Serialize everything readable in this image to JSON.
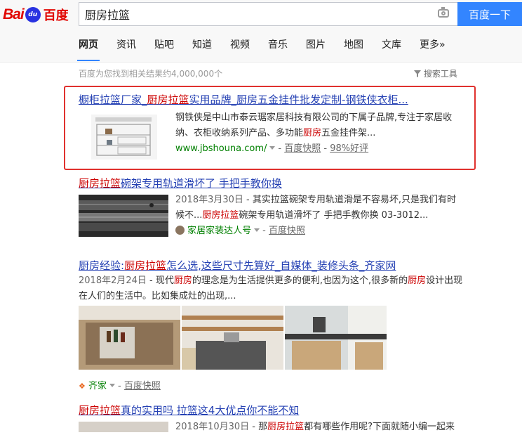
{
  "logo": {
    "latin": "Bai",
    "paw": "du",
    "cn": "百度"
  },
  "search": {
    "query": "厨房拉篮",
    "button": "百度一下"
  },
  "tabs": [
    "网页",
    "资讯",
    "贴吧",
    "知道",
    "视频",
    "音乐",
    "图片",
    "地图",
    "文库",
    "更多»"
  ],
  "count_text": "百度为您找到相关结果约4,000,000个",
  "tools_text": "搜索工具",
  "results": [
    {
      "title_pre": "橱柜拉篮厂家_",
      "title_em": "厨房拉篮",
      "title_post": "实用品牌_厨房五金挂件批发定制-钢铁侠衣柜...",
      "abstract_l1": "钢铁侠是中山市泰云琚家居科技有限公司的下属子品牌,专注于家居收",
      "abstract_l2_pre": "纳、衣柜收纳系列产品、多功能",
      "abstract_l2_em": "厨房",
      "abstract_l2_post": "五金挂件架...",
      "url": "www.jbshouna.com/",
      "cache": "百度快照",
      "rating": "98%好评"
    },
    {
      "title_em": "厨房拉篮",
      "title_post": "碗架专用轨道滑坏了 手把手教你换",
      "date": "2018年3月30日",
      "abstract_l1": " - 其实拉篮碗架专用轨道滑是不容易坏,只是我们有时",
      "abstract_l2_pre": "候不...",
      "abstract_l2_em": "厨房拉篮",
      "abstract_l2_post": "碗架专用轨道滑坏了 手把手教你换 03-3012...",
      "source": "家居家装达人号",
      "cache": "百度快照"
    },
    {
      "title_pre": "厨房经验:",
      "title_em": "厨房拉篮",
      "title_post": "怎么选,这些尺寸先算好_自媒体_装修头条_齐家网",
      "date": "2018年2月24日",
      "abstract_l1_pre": " - 现代",
      "abstract_l1_em": "厨房",
      "abstract_l1_mid": "的理念是为生活提供更多的便利,也因为这个,很多新的",
      "abstract_l1_em2": "厨房",
      "abstract_l1_post": "设计出现",
      "abstract_l2": "在人们的生活中。比如集成灶的出现,...",
      "source": "齐家",
      "cache": "百度快照"
    },
    {
      "title_em": "厨房拉篮",
      "title_post": "真的实用吗 拉篮这4大优点你不能不知",
      "date": "2018年10月30日",
      "abstract_pre": " - 那",
      "abstract_em": "厨房拉篮",
      "abstract_post": "都有哪些作用呢?下面就随小编一起来"
    }
  ]
}
